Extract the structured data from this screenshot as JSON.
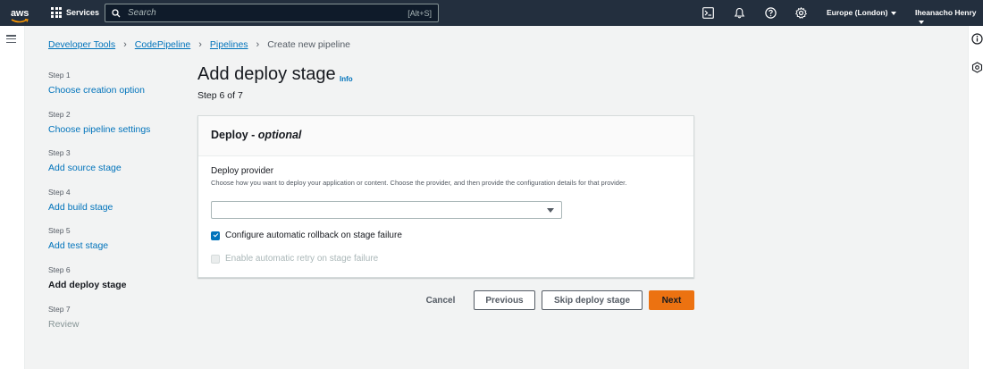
{
  "topnav": {
    "logo_text": "aws",
    "services_label": "Services",
    "search_placeholder": "Search",
    "search_shortcut": "[Alt+S]",
    "region": "Europe (London)",
    "user": "Iheanacho Henry"
  },
  "breadcrumb": {
    "items": [
      "Developer Tools",
      "CodePipeline",
      "Pipelines"
    ],
    "current": "Create new pipeline"
  },
  "steps": [
    {
      "num": "Step 1",
      "label": "Choose creation option",
      "state": "link"
    },
    {
      "num": "Step 2",
      "label": "Choose pipeline settings",
      "state": "link"
    },
    {
      "num": "Step 3",
      "label": "Add source stage",
      "state": "link"
    },
    {
      "num": "Step 4",
      "label": "Add build stage",
      "state": "link"
    },
    {
      "num": "Step 5",
      "label": "Add test stage",
      "state": "link"
    },
    {
      "num": "Step 6",
      "label": "Add deploy stage",
      "state": "active"
    },
    {
      "num": "Step 7",
      "label": "Review",
      "state": "disabled"
    }
  ],
  "page": {
    "title": "Add deploy stage",
    "info_link": "Info",
    "step_of": "Step 6 of 7"
  },
  "card": {
    "header_main": "Deploy - ",
    "header_optional": "optional",
    "field_label": "Deploy provider",
    "field_description": "Choose how you want to deploy your application or content. Choose the provider, and then provide the configuration details for that provider.",
    "select_value": "",
    "checkbox_rollback": {
      "label": "Configure automatic rollback on stage failure",
      "checked": true
    },
    "checkbox_retry": {
      "label": "Enable automatic retry on stage failure",
      "checked": false,
      "disabled": true
    }
  },
  "buttons": {
    "cancel": "Cancel",
    "previous": "Previous",
    "skip": "Skip deploy stage",
    "next": "Next"
  },
  "colors": {
    "nav_bg": "#232f3e",
    "link": "#0073bb",
    "primary_button": "#ec7211",
    "page_bg": "#f2f3f3"
  }
}
